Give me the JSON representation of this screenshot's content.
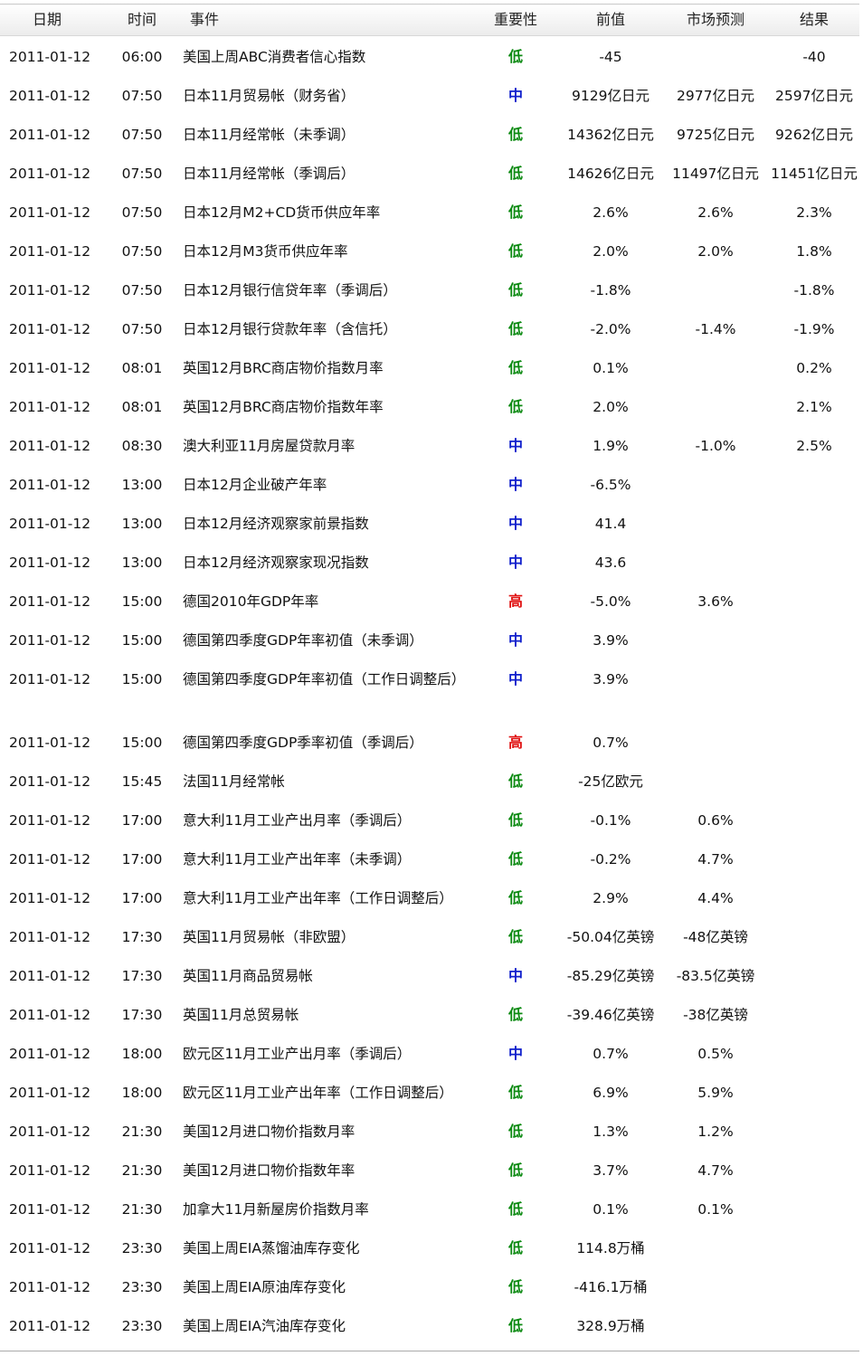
{
  "headers": {
    "date": "日期",
    "time": "时间",
    "event": "事件",
    "importance": "重要性",
    "previous": "前值",
    "forecast": "市场预测",
    "result": "结果"
  },
  "level_colors": {
    "低": "#0c8a12",
    "中": "#1020cc",
    "高": "#e01010"
  },
  "rows": [
    {
      "date": "2011-01-12",
      "time": "06:00",
      "event": "美国上周ABC消费者信心指数",
      "importance": "低",
      "previous": "-45",
      "forecast": "",
      "result": "-40"
    },
    {
      "date": "2011-01-12",
      "time": "07:50",
      "event": "日本11月贸易帐（财务省）",
      "importance": "中",
      "previous": "9129亿日元",
      "forecast": "2977亿日元",
      "result": "2597亿日元"
    },
    {
      "date": "2011-01-12",
      "time": "07:50",
      "event": "日本11月经常帐（未季调）",
      "importance": "低",
      "previous": "14362亿日元",
      "forecast": "9725亿日元",
      "result": "9262亿日元"
    },
    {
      "date": "2011-01-12",
      "time": "07:50",
      "event": "日本11月经常帐（季调后）",
      "importance": "低",
      "previous": "14626亿日元",
      "forecast": "11497亿日元",
      "result": "11451亿日元"
    },
    {
      "date": "2011-01-12",
      "time": "07:50",
      "event": "日本12月M2+CD货币供应年率",
      "importance": "低",
      "previous": "2.6%",
      "forecast": "2.6%",
      "result": "2.3%"
    },
    {
      "date": "2011-01-12",
      "time": "07:50",
      "event": "日本12月M3货币供应年率",
      "importance": "低",
      "previous": "2.0%",
      "forecast": "2.0%",
      "result": "1.8%"
    },
    {
      "date": "2011-01-12",
      "time": "07:50",
      "event": "日本12月银行信贷年率（季调后）",
      "importance": "低",
      "previous": "-1.8%",
      "forecast": "",
      "result": "-1.8%"
    },
    {
      "date": "2011-01-12",
      "time": "07:50",
      "event": "日本12月银行贷款年率（含信托）",
      "importance": "低",
      "previous": "-2.0%",
      "forecast": "-1.4%",
      "result": "-1.9%"
    },
    {
      "date": "2011-01-12",
      "time": "08:01",
      "event": "英国12月BRC商店物价指数月率",
      "importance": "低",
      "previous": "0.1%",
      "forecast": "",
      "result": "0.2%"
    },
    {
      "date": "2011-01-12",
      "time": "08:01",
      "event": "英国12月BRC商店物价指数年率",
      "importance": "低",
      "previous": "2.0%",
      "forecast": "",
      "result": "2.1%"
    },
    {
      "date": "2011-01-12",
      "time": "08:30",
      "event": "澳大利亚11月房屋贷款月率",
      "importance": "中",
      "previous": "1.9%",
      "forecast": "-1.0%",
      "result": "2.5%"
    },
    {
      "date": "2011-01-12",
      "time": "13:00",
      "event": "日本12月企业破产年率",
      "importance": "中",
      "previous": "-6.5%",
      "forecast": "",
      "result": ""
    },
    {
      "date": "2011-01-12",
      "time": "13:00",
      "event": "日本12月经济观察家前景指数",
      "importance": "中",
      "previous": "41.4",
      "forecast": "",
      "result": ""
    },
    {
      "date": "2011-01-12",
      "time": "13:00",
      "event": "日本12月经济观察家现况指数",
      "importance": "中",
      "previous": "43.6",
      "forecast": "",
      "result": ""
    },
    {
      "date": "2011-01-12",
      "time": "15:00",
      "event": "德国2010年GDP年率",
      "importance": "高",
      "previous": "-5.0%",
      "forecast": "3.6%",
      "result": ""
    },
    {
      "date": "2011-01-12",
      "time": "15:00",
      "event": "德国第四季度GDP年率初值（未季调）",
      "importance": "中",
      "previous": "3.9%",
      "forecast": "",
      "result": ""
    },
    {
      "date": "2011-01-12",
      "time": "15:00",
      "event": "德国第四季度GDP年率初值（工作日调整后）",
      "importance": "中",
      "previous": "3.9%",
      "forecast": "",
      "result": ""
    },
    {
      "date": "2011-01-12",
      "time": "15:00",
      "event": "德国第四季度GDP季率初值（季调后）",
      "importance": "高",
      "previous": "0.7%",
      "forecast": "",
      "result": ""
    },
    {
      "date": "2011-01-12",
      "time": "15:45",
      "event": "法国11月经常帐",
      "importance": "低",
      "previous": "-25亿欧元",
      "forecast": "",
      "result": ""
    },
    {
      "date": "2011-01-12",
      "time": "17:00",
      "event": "意大利11月工业产出月率（季调后）",
      "importance": "低",
      "previous": "-0.1%",
      "forecast": "0.6%",
      "result": ""
    },
    {
      "date": "2011-01-12",
      "time": "17:00",
      "event": "意大利11月工业产出年率（未季调）",
      "importance": "低",
      "previous": "-0.2%",
      "forecast": "4.7%",
      "result": ""
    },
    {
      "date": "2011-01-12",
      "time": "17:00",
      "event": "意大利11月工业产出年率（工作日调整后）",
      "importance": "低",
      "previous": "2.9%",
      "forecast": "4.4%",
      "result": ""
    },
    {
      "date": "2011-01-12",
      "time": "17:30",
      "event": "英国11月贸易帐（非欧盟）",
      "importance": "低",
      "previous": "-50.04亿英镑",
      "forecast": "-48亿英镑",
      "result": ""
    },
    {
      "date": "2011-01-12",
      "time": "17:30",
      "event": "英国11月商品贸易帐",
      "importance": "中",
      "previous": "-85.29亿英镑",
      "forecast": "-83.5亿英镑",
      "result": ""
    },
    {
      "date": "2011-01-12",
      "time": "17:30",
      "event": "英国11月总贸易帐",
      "importance": "低",
      "previous": "-39.46亿英镑",
      "forecast": "-38亿英镑",
      "result": ""
    },
    {
      "date": "2011-01-12",
      "time": "18:00",
      "event": "欧元区11月工业产出月率（季调后）",
      "importance": "中",
      "previous": "0.7%",
      "forecast": "0.5%",
      "result": ""
    },
    {
      "date": "2011-01-12",
      "time": "18:00",
      "event": "欧元区11月工业产出年率（工作日调整后）",
      "importance": "低",
      "previous": "6.9%",
      "forecast": "5.9%",
      "result": ""
    },
    {
      "date": "2011-01-12",
      "time": "21:30",
      "event": "美国12月进口物价指数月率",
      "importance": "低",
      "previous": "1.3%",
      "forecast": "1.2%",
      "result": ""
    },
    {
      "date": "2011-01-12",
      "time": "21:30",
      "event": "美国12月进口物价指数年率",
      "importance": "低",
      "previous": "3.7%",
      "forecast": "4.7%",
      "result": ""
    },
    {
      "date": "2011-01-12",
      "time": "21:30",
      "event": "加拿大11月新屋房价指数月率",
      "importance": "低",
      "previous": "0.1%",
      "forecast": "0.1%",
      "result": ""
    },
    {
      "date": "2011-01-12",
      "time": "23:30",
      "event": "美国上周EIA蒸馏油库存变化",
      "importance": "低",
      "previous": "114.8万桶",
      "forecast": "",
      "result": ""
    },
    {
      "date": "2011-01-12",
      "time": "23:30",
      "event": "美国上周EIA原油库存变化",
      "importance": "低",
      "previous": "-416.1万桶",
      "forecast": "",
      "result": ""
    },
    {
      "date": "2011-01-12",
      "time": "23:30",
      "event": "美国上周EIA汽油库存变化",
      "importance": "低",
      "previous": "328.9万桶",
      "forecast": "",
      "result": ""
    }
  ]
}
